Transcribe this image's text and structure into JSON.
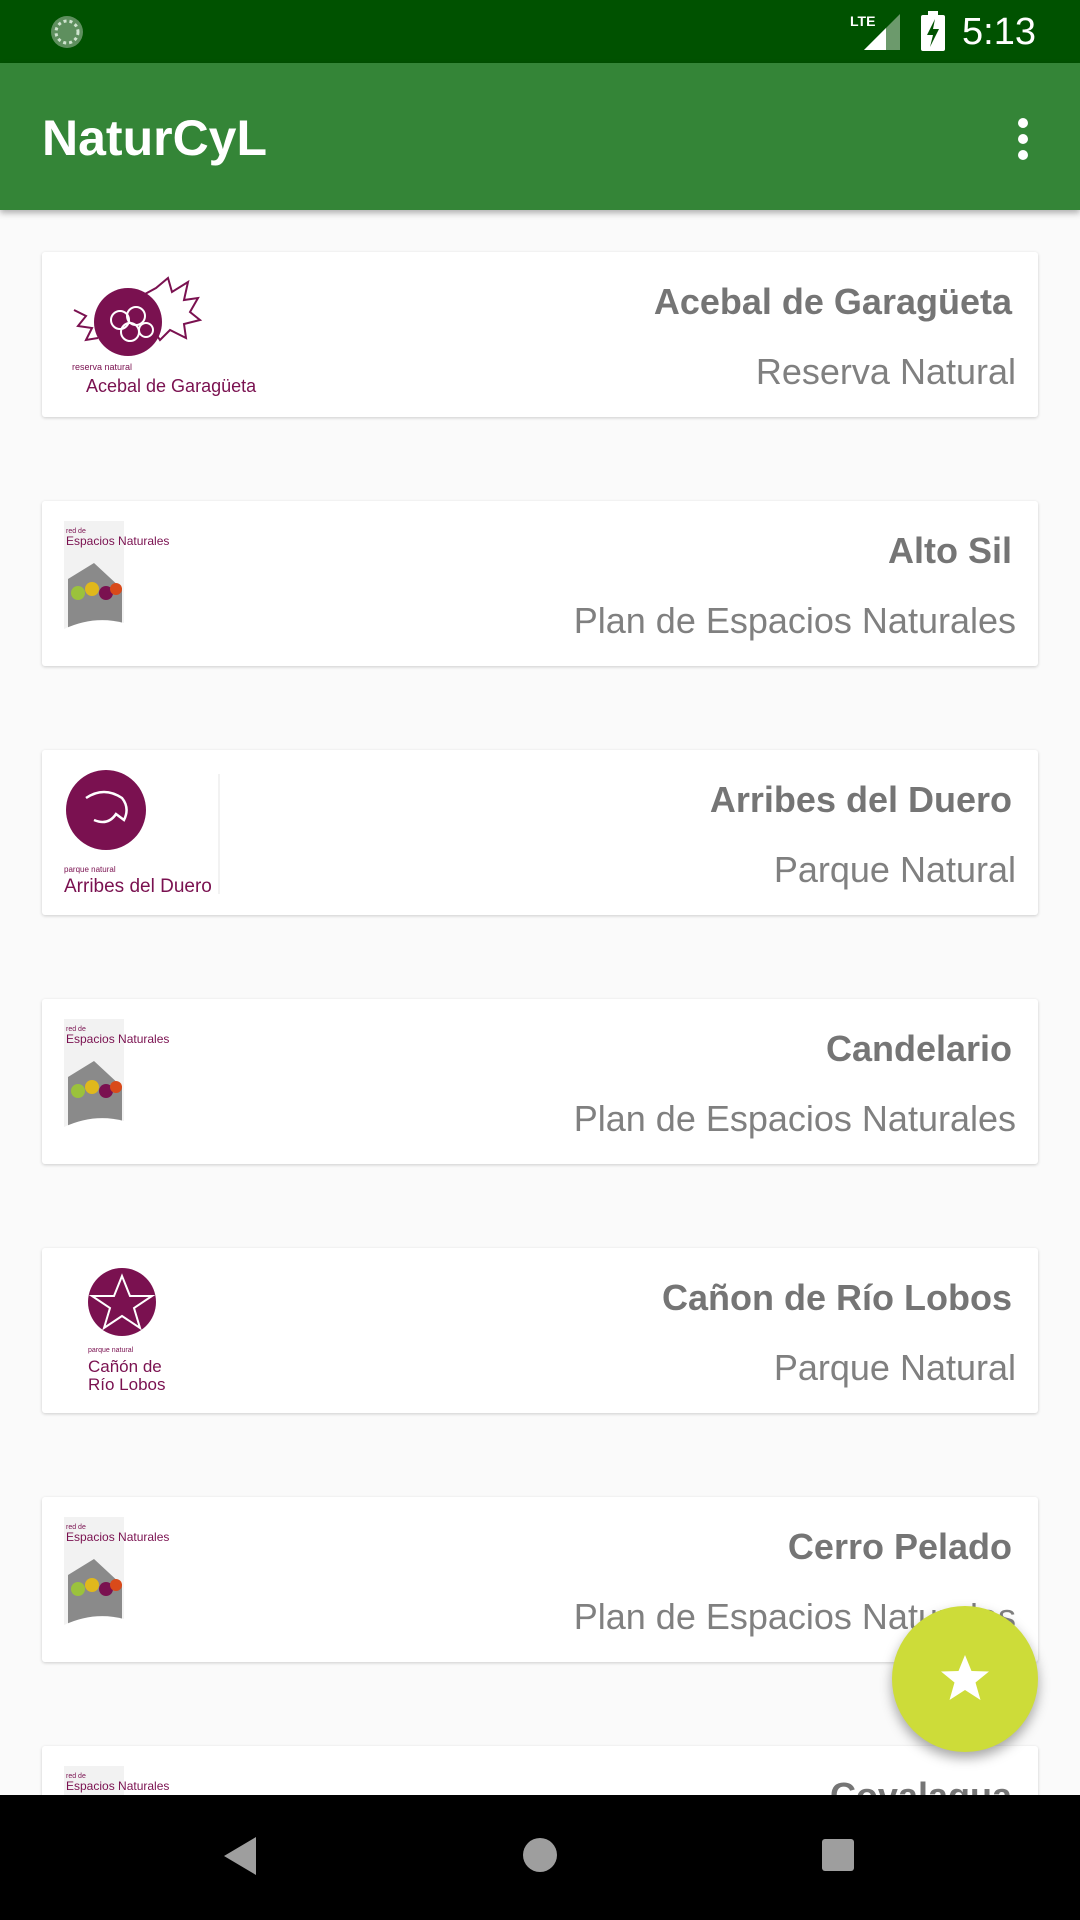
{
  "status_bar": {
    "time": "5:13",
    "network": "LTE",
    "icons": [
      "sync-icon",
      "lte-signal-icon",
      "battery-charging-icon"
    ]
  },
  "app_bar": {
    "title": "NaturCyL",
    "menu_icon": "overflow-menu-icon"
  },
  "colors": {
    "status_bar": "#005200",
    "app_bar": "#348537",
    "fab": "#cddc39",
    "logo_accent": "#7a1150"
  },
  "spaces": [
    {
      "name": "Acebal de Garagüeta",
      "type": "Reserva Natural",
      "logo": "acebal-de-garagueta-logo",
      "logo_text_small": "reserva natural",
      "logo_text": "Acebal de Garagüeta"
    },
    {
      "name": "Alto Sil",
      "type": "Plan de Espacios Naturales",
      "logo": "red-espacios-naturales-logo",
      "logo_text": "Espacios Naturales"
    },
    {
      "name": "Arribes del Duero",
      "type": "Parque Natural",
      "logo": "arribes-del-duero-logo",
      "logo_text_small": "parque natural",
      "logo_text": "Arribes del Duero"
    },
    {
      "name": "Candelario",
      "type": "Plan de Espacios Naturales",
      "logo": "red-espacios-naturales-logo",
      "logo_text": "Espacios Naturales"
    },
    {
      "name": "Cañon de Río Lobos",
      "type": "Parque Natural",
      "logo": "canon-rio-lobos-logo",
      "logo_text_small": "parque natural",
      "logo_text": "Cañón de Río Lobos"
    },
    {
      "name": "Cerro Pelado",
      "type": "Plan de Espacios Naturales",
      "logo": "red-espacios-naturales-logo",
      "logo_text": "Espacios Naturales"
    },
    {
      "name": "Covalagua",
      "type": "",
      "logo": "red-espacios-naturales-logo",
      "logo_text": "Espacios Naturales"
    }
  ],
  "fab": {
    "icon": "star-icon"
  },
  "nav_bar": {
    "icons": [
      "back-icon",
      "home-icon",
      "recents-icon"
    ]
  }
}
